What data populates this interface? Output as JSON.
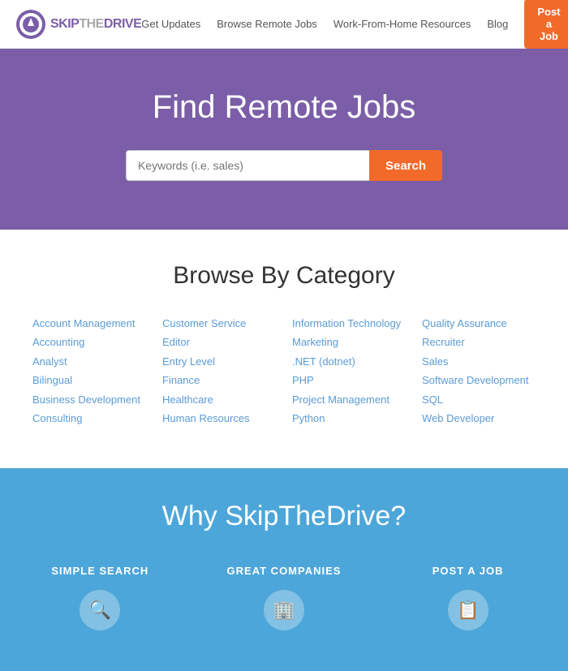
{
  "header": {
    "logo_text_skip": "SKIP",
    "logo_text_the": "THE",
    "logo_text_drive": "DRIVE",
    "nav_items": [
      {
        "label": "Get Updates",
        "href": "#"
      },
      {
        "label": "Browse Remote Jobs",
        "href": "#"
      },
      {
        "label": "Work-From-Home Resources",
        "href": "#"
      },
      {
        "label": "Blog",
        "href": "#"
      }
    ],
    "post_job_label": "Post a Job"
  },
  "hero": {
    "title": "Find Remote Jobs",
    "search_placeholder": "Keywords (i.e. sales)",
    "search_button_label": "Search"
  },
  "category_section": {
    "title": "Browse By Category",
    "columns": [
      {
        "items": [
          "Account Management",
          "Accounting",
          "Analyst",
          "Bilingual",
          "Business Development",
          "Consulting"
        ]
      },
      {
        "items": [
          "Customer Service",
          "Editor",
          "Entry Level",
          "Finance",
          "Healthcare",
          "Human Resources"
        ]
      },
      {
        "items": [
          "Information Technology",
          "Marketing",
          ".NET (dotnet)",
          "PHP",
          "Project Management",
          "Python"
        ]
      },
      {
        "items": [
          "Quality Assurance",
          "Recruiter",
          "Sales",
          "Software Development",
          "SQL",
          "Web Developer"
        ]
      }
    ]
  },
  "why_section": {
    "title": "Why SkipTheDrive?",
    "items": [
      {
        "label": "SIMPLE SEARCH",
        "icon": "🔍"
      },
      {
        "label": "GREAT COMPANIES",
        "icon": "🏢"
      },
      {
        "label": "POST A JOB",
        "icon": "📋"
      }
    ]
  }
}
